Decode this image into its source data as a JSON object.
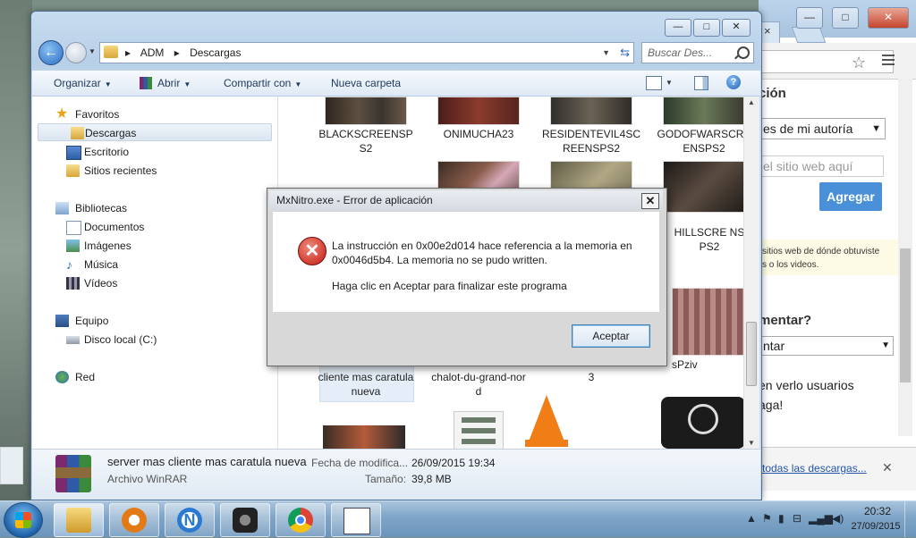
{
  "explorer": {
    "window_controls": {
      "minimize": "—",
      "maximize": "□",
      "close": "✕"
    },
    "breadcrumb": [
      "ADM",
      "Descargas"
    ],
    "search_placeholder": "Buscar Des...",
    "toolbar": {
      "organize": "Organizar",
      "open": "Abrir",
      "share": "Compartir con",
      "new_folder": "Nueva carpeta"
    },
    "nav": {
      "favorites": "Favoritos",
      "downloads": "Descargas",
      "desktop": "Escritorio",
      "recent": "Sitios recientes",
      "libraries": "Bibliotecas",
      "documents": "Documentos",
      "images": "Imágenes",
      "music": "Música",
      "videos": "Vídeos",
      "computer": "Equipo",
      "local_disk": "Disco local (C:)",
      "network": "Red"
    },
    "files": {
      "f1": "BLACKSCREENSPS2",
      "f2": "ONIMUCHA23",
      "f3": "RESIDENTEVIL4SCREENSPS2",
      "f4": "GODOFWARSCREENSPS2",
      "f5": "HILLSCRE NSPS2",
      "f6": "sPziv",
      "f7": "cliente mas caratula nueva",
      "f8": "chalot-du-grand-nord",
      "f9": "3"
    },
    "details": {
      "name": "server mas cliente mas caratula nueva",
      "type": "Archivo WinRAR",
      "modified_label": "Fecha de modifica...",
      "modified_value": "26/09/2015 19:34",
      "size_label": "Tamaño:",
      "size_value": "39,8 MB"
    }
  },
  "dialog": {
    "title": "MxNitro.exe - Error de aplicación",
    "close": "✕",
    "message": "La instrucción en 0x00e2d014 hace referencia a la memoria en 0x0046d5b4. La memoria no se pudo written.",
    "hint": "Haga clic en Aceptar para finalizar este programa",
    "ok_button": "Aceptar"
  },
  "chrome": {
    "tab_close": "×",
    "window_controls": {
      "minimize": "—",
      "maximize": "□",
      "close": "✕"
    },
    "section_title": "ción",
    "select_value": "es de mi autoría",
    "input_placeholder": "el sitio web aquí",
    "add_button": "Agregar",
    "note_line1": "sitios web de dónde obtuviste",
    "note_line2": "s o los videos.",
    "question": "mentar?",
    "select2_value": "ntar",
    "text_line1": "en verlo usuarios",
    "text_line2": "aga!",
    "downloads_link": "todas las descargas...",
    "downloads_close": "✕"
  },
  "taskbar": {
    "time": "20:32",
    "date": "27/09/2015"
  },
  "colors": {
    "accent": "#4a90d9",
    "error": "#c21a12",
    "vlc": "#f07d16"
  }
}
